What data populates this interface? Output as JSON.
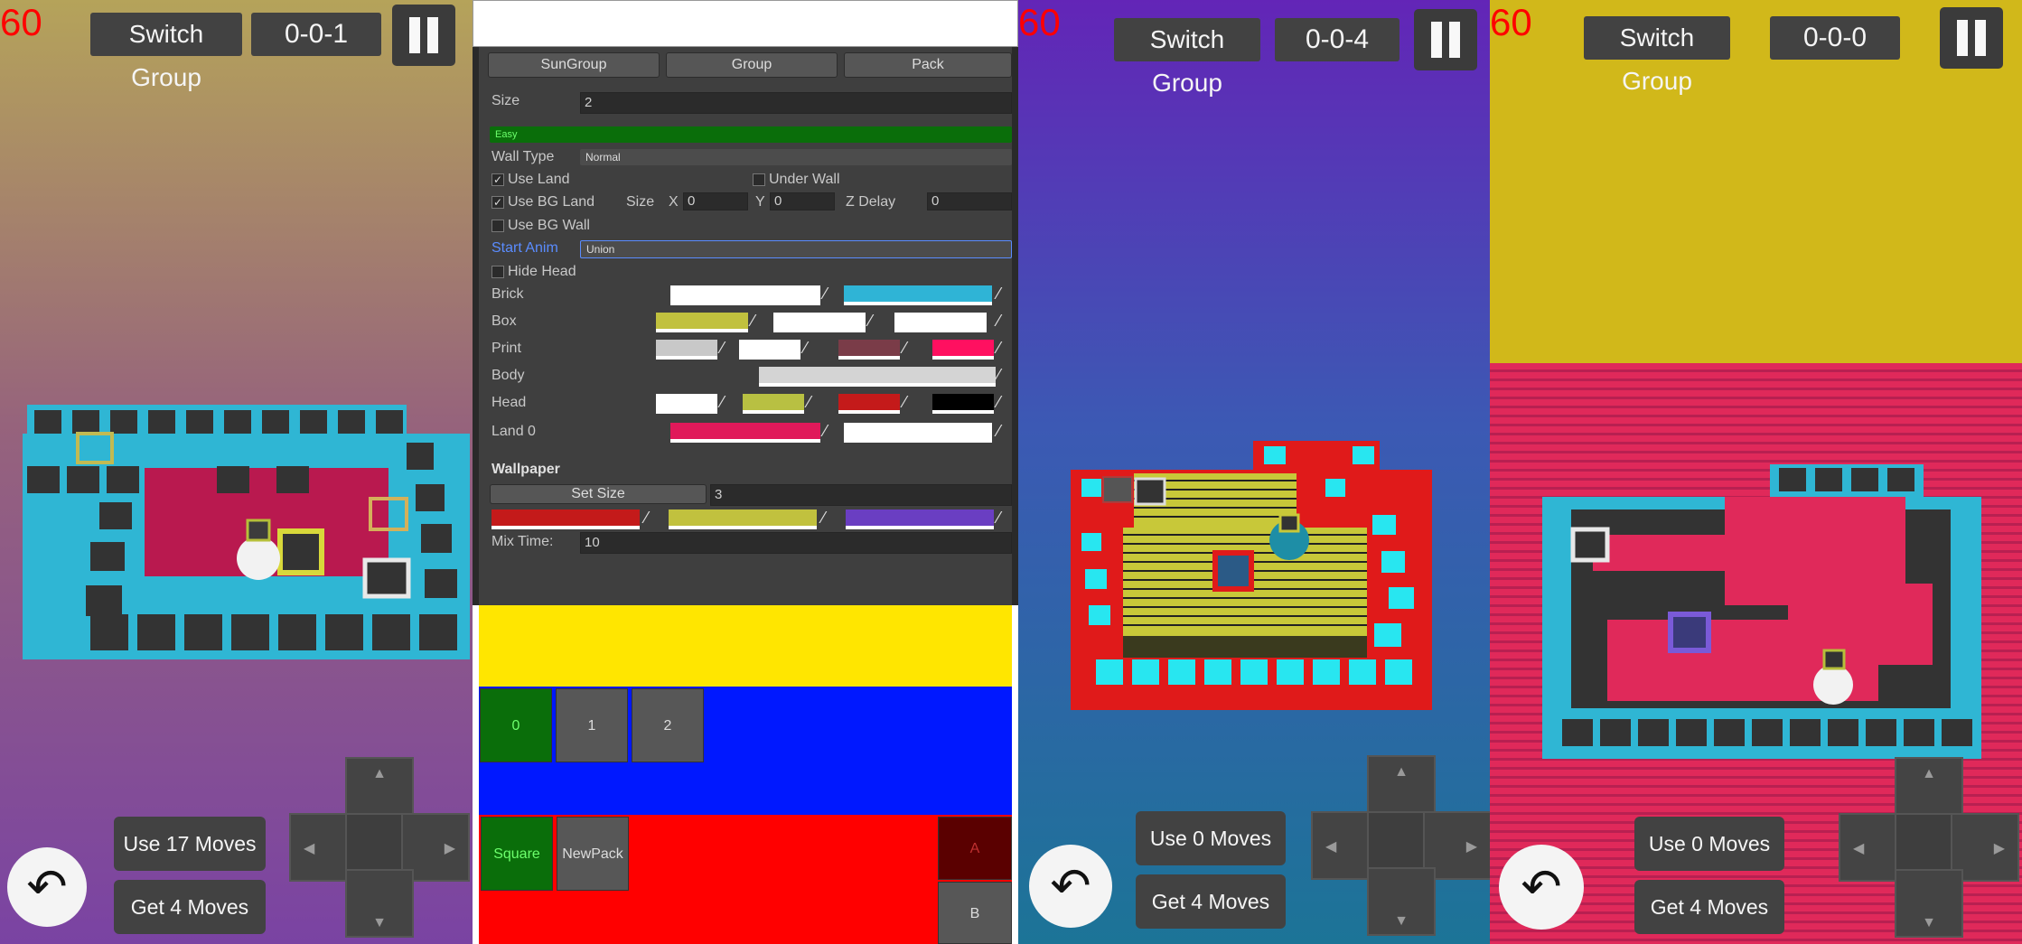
{
  "screen1": {
    "fps": "60",
    "switch_group": "Switch Group",
    "level": "0-0-1",
    "use_moves": "Use 17 Moves",
    "get_moves": "Get 4 Moves"
  },
  "editor": {
    "tabs": [
      "SunGroup",
      "Group",
      "Pack"
    ],
    "size_label": "Size",
    "size_value": "2",
    "difficulty": "Easy",
    "wall_type_label": "Wall Type",
    "wall_type_value": "Normal",
    "use_land": "Use Land",
    "under_wall": "Under Wall",
    "use_bg_land": "Use BG Land",
    "size2_label": "Size",
    "x_label": "X",
    "x_value": "0",
    "y_label": "Y",
    "y_value": "0",
    "zdelay_label": "Z Delay",
    "zdelay_value": "0",
    "use_bg_wall": "Use BG Wall",
    "start_anim_label": "Start Anim",
    "start_anim_value": "Union",
    "hide_head": "Hide Head",
    "rows": [
      "Brick",
      "Box",
      "Print",
      "Body",
      "Head",
      "Land 0"
    ],
    "wallpaper_label": "Wallpaper",
    "set_size": "Set Size",
    "set_size_value": "3",
    "mix_time_label": "Mix Time:",
    "mix_time_value": "10",
    "levels": [
      "0",
      "1",
      "2"
    ],
    "packs": [
      "Square",
      "NewPack"
    ],
    "side_a": "A",
    "side_b": "B",
    "colors": {
      "brick": [
        "#ffffff",
        "#2fb4d6"
      ],
      "box": [
        "#c1c13e",
        "#ffffff",
        "#ffffff"
      ],
      "print": [
        "#c8c8c8",
        "#ffffff",
        "#7a3c48",
        "#ff1060"
      ],
      "body": [
        "#d4d4d4"
      ],
      "head": [
        "#ffffff",
        "#b8c042",
        "#c41a1a",
        "#000000"
      ],
      "land0": [
        "#e0195a",
        "#ffffff"
      ],
      "wallpaper": [
        "#c41a1a",
        "#c1c13e",
        "#6a3ec2"
      ],
      "band_yellow": "#ffe600",
      "band_blue": "#0018ff",
      "band_red": "#ff0000"
    }
  },
  "screen3": {
    "fps": "60",
    "switch_group": "Switch Group",
    "level": "0-0-4",
    "use_moves": "Use 0 Moves",
    "get_moves": "Get 4 Moves"
  },
  "screen4": {
    "fps": "60",
    "switch_group": "Switch Group",
    "level": "0-0-0",
    "use_moves": "Use 0 Moves",
    "get_moves": "Get 4 Moves"
  },
  "icons": {
    "undo": "↶",
    "up": "▲",
    "down": "▼",
    "left": "◀",
    "right": "▶"
  }
}
